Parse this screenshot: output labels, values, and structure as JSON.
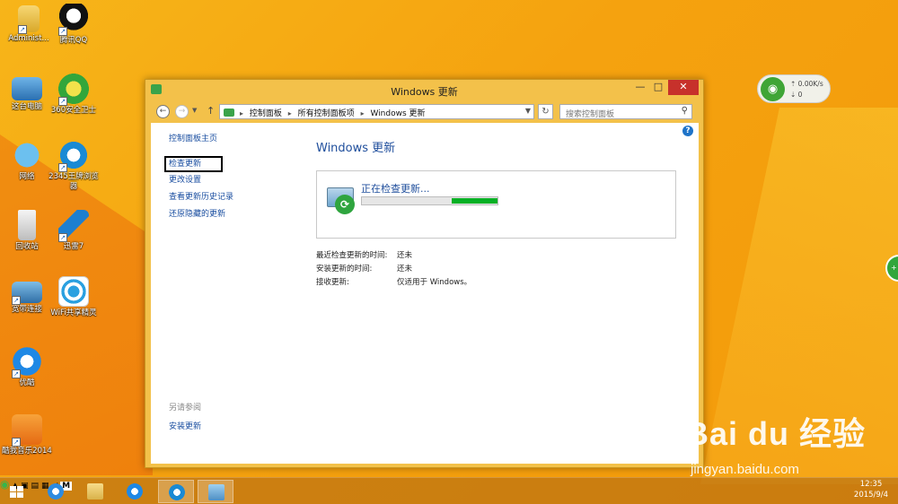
{
  "desktop": {
    "icons": [
      {
        "label": "Administ..."
      },
      {
        "label": "腾讯QQ"
      },
      {
        "label": "这台电脑"
      },
      {
        "label": "360安全卫士"
      },
      {
        "label": "网络"
      },
      {
        "label": "2345王牌浏览器"
      },
      {
        "label": "回收站"
      },
      {
        "label": "迅雷7"
      },
      {
        "label": "宽带连接"
      },
      {
        "label": "WiFi共享精灵"
      },
      {
        "label": "优酷"
      },
      {
        "label": "酷我音乐2014"
      }
    ]
  },
  "window": {
    "title": "Windows 更新",
    "controls": {
      "minimize": "—",
      "maximize": "□",
      "close": "✕"
    },
    "address": {
      "crumbs": [
        "控制面板",
        "所有控制面板项",
        "Windows 更新"
      ],
      "search_placeholder": "搜索控制面板"
    },
    "sidebar": {
      "home": "控制面板主页",
      "items": [
        "检查更新",
        "更改设置",
        "查看更新历史记录",
        "还原隐藏的更新"
      ],
      "see_also_label": "另请参阅",
      "see_also_items": [
        "安装更新"
      ]
    },
    "main": {
      "title": "Windows 更新",
      "status_message": "正在检查更新...",
      "progress": {
        "fill_start": 0.66,
        "fill_end": 1.0
      },
      "info": [
        {
          "key": "最近检查更新的时间:",
          "value": "还未"
        },
        {
          "key": "安装更新的时间:",
          "value": "还未"
        },
        {
          "key": "接收更新:",
          "value": "仅适用于 Windows。"
        }
      ]
    }
  },
  "net_widget": {
    "up": "0.00K/s",
    "down": "0"
  },
  "watermark": {
    "brand": "Bai du 经验",
    "url": "jingyan.baidu.com"
  },
  "taskbar": {
    "time": "12:35",
    "date": "2015/9/4",
    "ime": "M"
  },
  "colors": {
    "accent": "#1f4e9c",
    "progress": "#06b025",
    "close": "#c7312b"
  }
}
